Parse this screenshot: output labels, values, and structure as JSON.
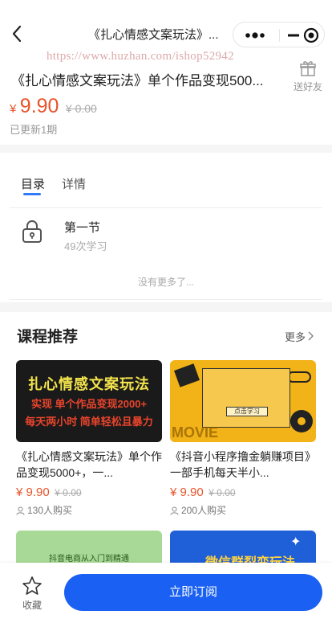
{
  "navbar": {
    "title": "《扎心情感文案玩法》..."
  },
  "watermark": "https://www.huzhan.com/ishop52942",
  "product": {
    "title": "《扎心情感文案玩法》单个作品变现500...",
    "share_label": "送好友",
    "price_symbol": "¥",
    "price": "9.90",
    "original_price": "¥ 0.00",
    "update_info": "已更新1期"
  },
  "tabs": [
    {
      "label": "目录",
      "active": true
    },
    {
      "label": "详情",
      "active": false
    }
  ],
  "chapters": [
    {
      "title": "第一节",
      "learners": "49次学习"
    }
  ],
  "no_more_text": "没有更多了...",
  "recommend": {
    "title": "课程推荐",
    "more_label": "更多",
    "courses": [
      {
        "title": "《扎心情感文案玩法》单个作品变现5000+，一...",
        "price": "¥ 9.90",
        "original_price": "¥ 0.00",
        "buyers": "130人购买",
        "cover": {
          "line1": "扎心情感文案玩法",
          "line2": "实现 单个作品变现2000+",
          "line3": "每天两小时 简单轻松且暴力"
        }
      },
      {
        "title": "《抖音小程序撸金躺赚项目》一部手机每天半小...",
        "price": "¥ 9.90",
        "original_price": "¥ 0.00",
        "buyers": "200人购买",
        "cover": {
          "button": "点击学习",
          "movie": "MOVIE"
        }
      },
      {
        "cover_text": "抖音电商从入门到精通"
      },
      {
        "cover_text": "微信群裂变玩法"
      }
    ]
  },
  "bottom_bar": {
    "favorite_label": "收藏",
    "subscribe_label": "立即订阅"
  },
  "colors": {
    "accent_blue": "#1a60f2",
    "price_red": "#e8542b"
  }
}
